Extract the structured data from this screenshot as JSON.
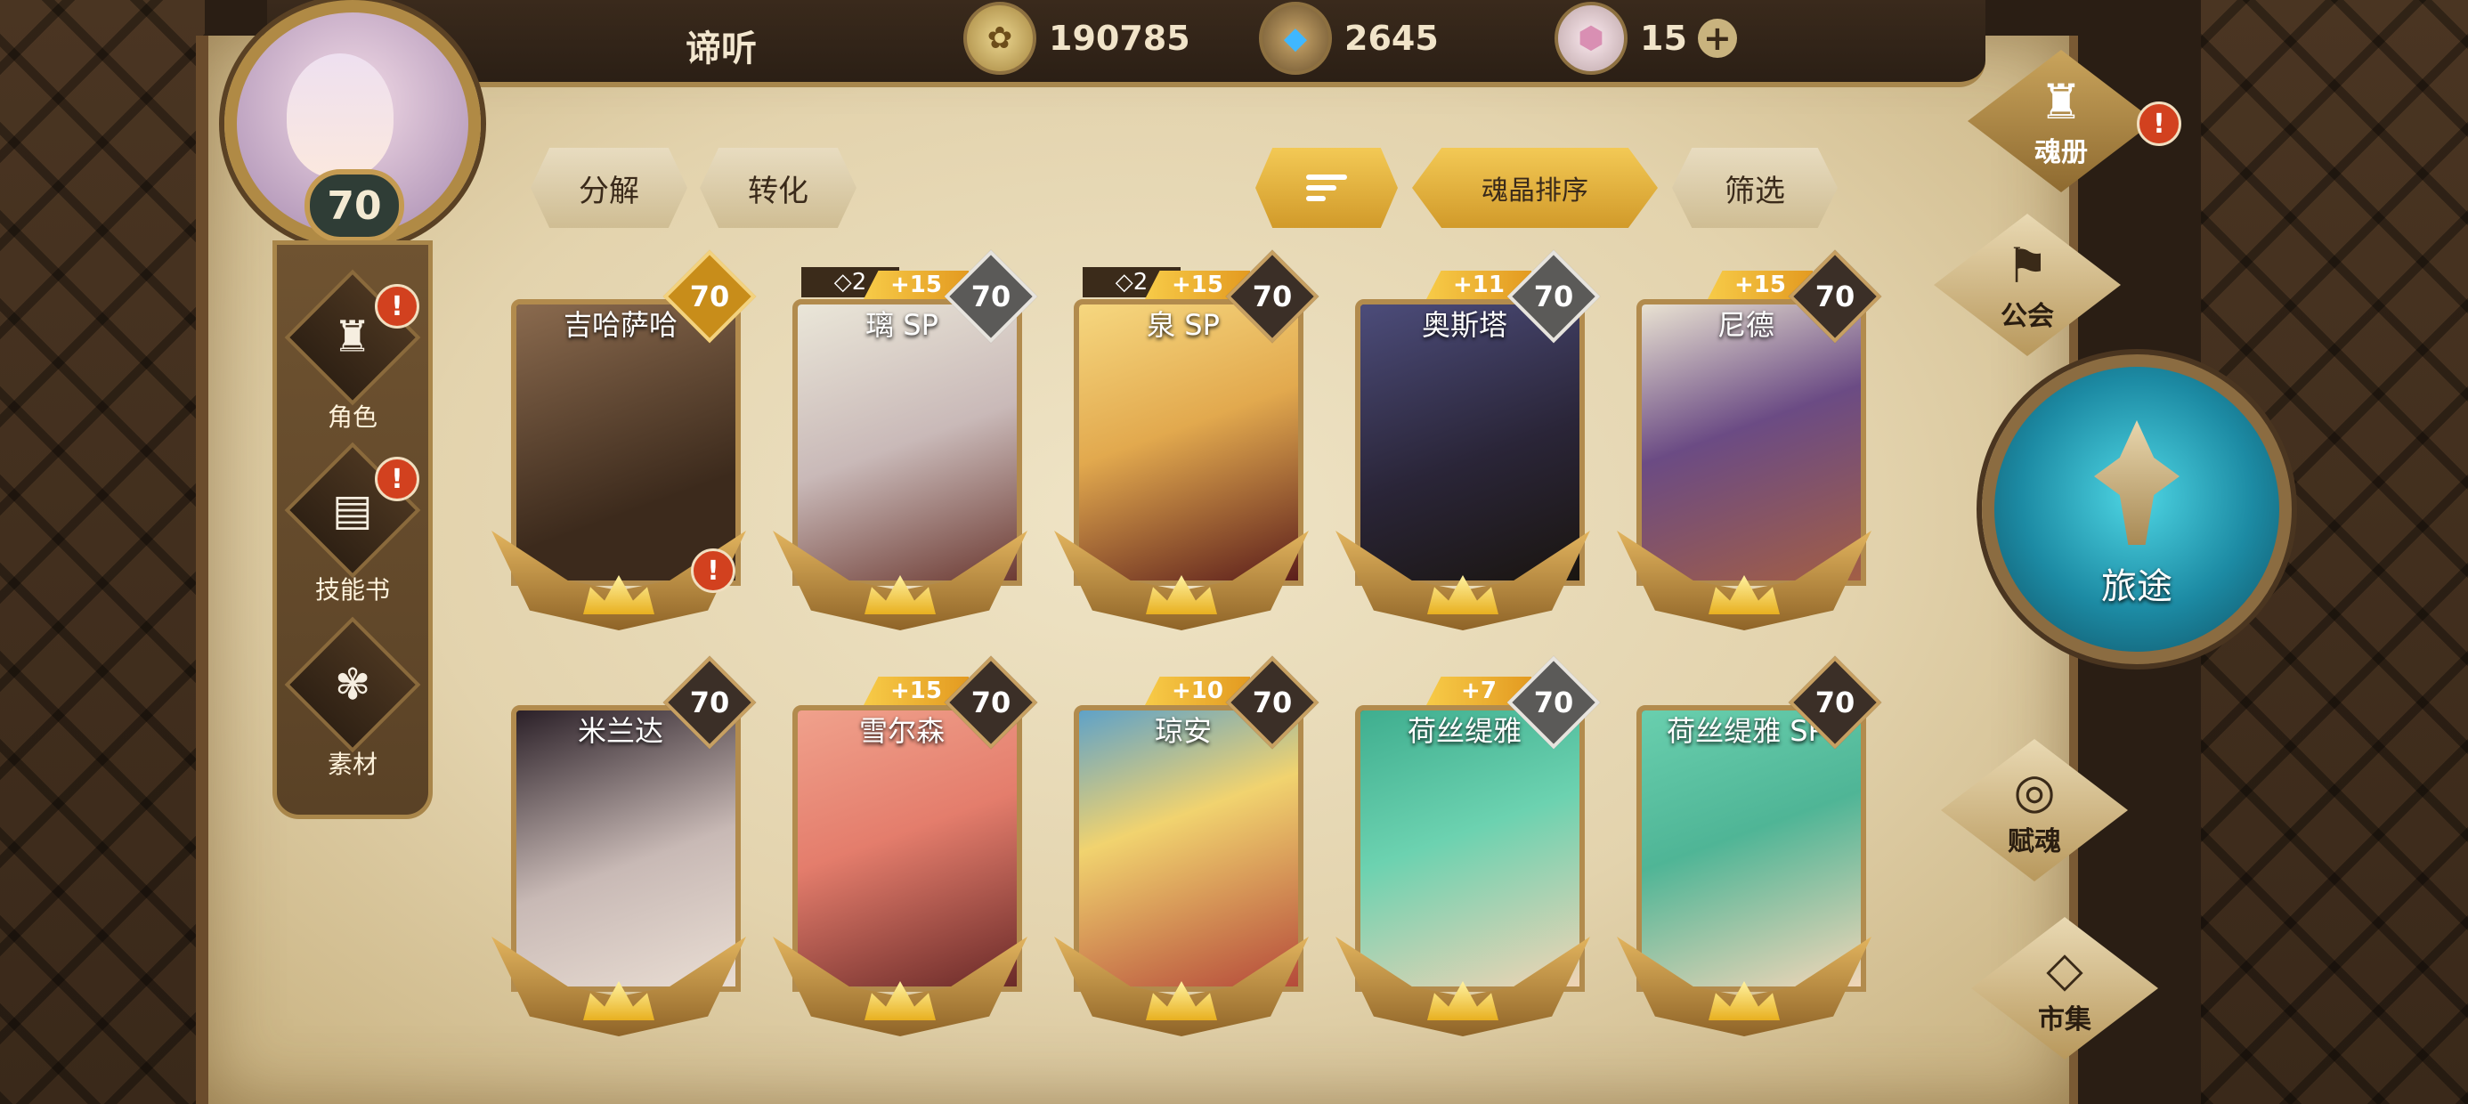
{
  "header": {
    "title": "谛听",
    "currencies": [
      {
        "icon": "gold-coin-icon",
        "value": "190785"
      },
      {
        "icon": "blue-crystal-icon",
        "value": "2645"
      },
      {
        "icon": "pink-gem-icon",
        "value": "15",
        "add": "+"
      }
    ]
  },
  "player": {
    "level": "70"
  },
  "left_nav": [
    {
      "label": "角色",
      "icon": "character-icon",
      "alert": "!"
    },
    {
      "label": "技能书",
      "icon": "skill-book-icon",
      "alert": "!"
    },
    {
      "label": "素材",
      "icon": "material-icon"
    }
  ],
  "toolbar": {
    "decompose": "分解",
    "convert": "转化",
    "sort_icon": "sort-order-icon",
    "soul_sort": "魂晶排序",
    "filter": "筛选"
  },
  "cards": [
    {
      "name": "吉哈萨哈",
      "level": "70",
      "level_style": "gold",
      "plus": "",
      "stars": "",
      "alert": "!"
    },
    {
      "name": "璃 SP",
      "level": "70",
      "level_style": "silver",
      "plus": "+15",
      "stars": "◇2"
    },
    {
      "name": "泉 SP",
      "level": "70",
      "level_style": "dark",
      "plus": "+15",
      "stars": "◇2"
    },
    {
      "name": "奥斯塔",
      "level": "70",
      "level_style": "silver",
      "plus": "+11",
      "stars": ""
    },
    {
      "name": "尼德",
      "level": "70",
      "level_style": "dark",
      "plus": "+15",
      "stars": ""
    },
    {
      "name": "米兰达",
      "level": "70",
      "level_style": "dark",
      "plus": "",
      "stars": ""
    },
    {
      "name": "雪尔森",
      "level": "70",
      "level_style": "dark",
      "plus": "+15",
      "stars": ""
    },
    {
      "name": "琼安",
      "level": "70",
      "level_style": "dark",
      "plus": "+10",
      "stars": ""
    },
    {
      "name": "荷丝缇雅",
      "level": "70",
      "level_style": "silver",
      "plus": "+7",
      "stars": ""
    },
    {
      "name": "荷丝缇雅 SP",
      "level": "70",
      "level_style": "dark",
      "plus": "",
      "stars": ""
    }
  ],
  "right_menu": {
    "soul_book": "魂册",
    "soul_book_alert": "!",
    "guild": "公会",
    "journey": "旅途",
    "endow": "赋魂",
    "market": "市集"
  }
}
